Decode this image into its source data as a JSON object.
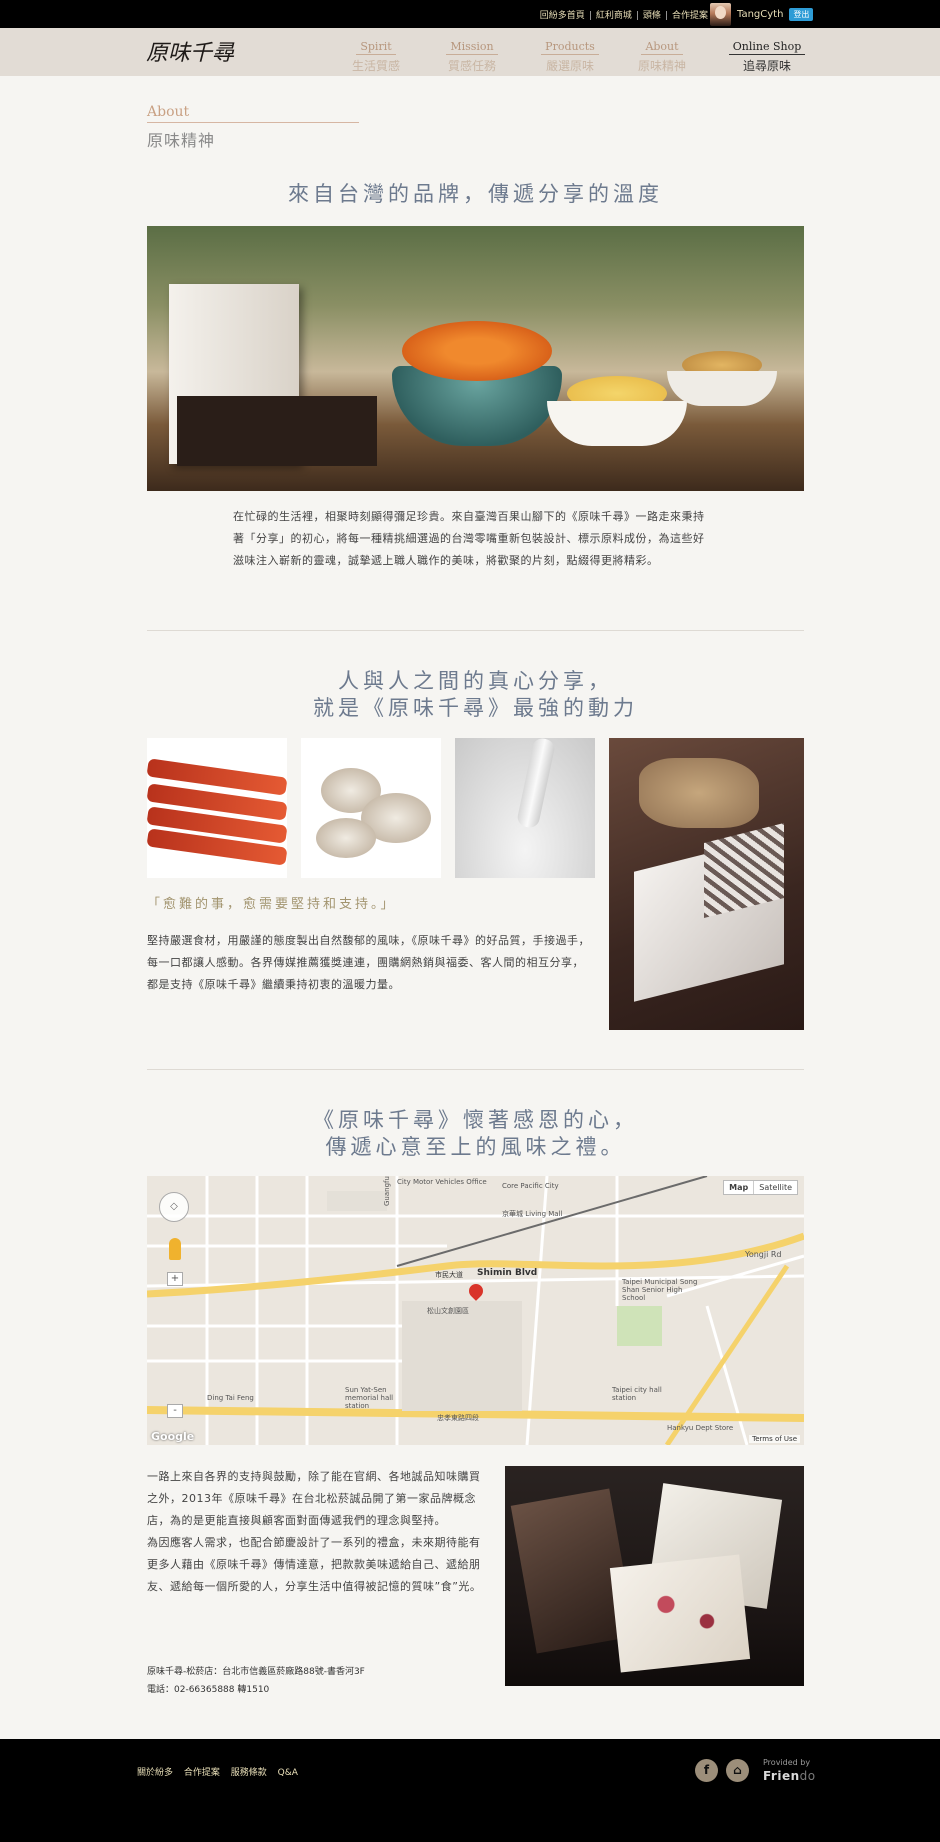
{
  "topbar": {
    "links": [
      "回紛多首頁",
      "紅利商城",
      "頭條",
      "合作提案"
    ],
    "user_name": "TangCyth",
    "logout_label": "登出"
  },
  "nav": {
    "logo_text": "原味千尋",
    "items": [
      {
        "en": "Spirit",
        "zh": "生活質感"
      },
      {
        "en": "Mission",
        "zh": "質感任務"
      },
      {
        "en": "Products",
        "zh": "嚴選原味"
      },
      {
        "en": "About",
        "zh": "原味精神"
      },
      {
        "en": "Online Shop",
        "zh": "追尋原味"
      }
    ]
  },
  "section": {
    "en": "About",
    "zh": "原味精神"
  },
  "headline1": "來自台灣的品牌，傳遞分享的溫度",
  "para1": "在忙碌的生活裡，相聚時刻顯得彌足珍貴。來自臺灣百果山腳下的《原味千尋》一路走來秉持著「分享」的初心，將每一種精挑細選過的台灣零嘴重新包裝設計、標示原料成份，為這些好滋味注入嶄新的靈魂，誠摯遞上職人職作的美味，將歡聚的片刻，點綴得更將精彩。",
  "headline2": [
    "人與人之間的真心分享，",
    "就是《原味千尋》最強的動力"
  ],
  "quote": "「愈難的事，愈需要堅持和支持。」",
  "para2": "堅持嚴選食材，用嚴謹的態度製出自然馥郁的風味，《原味千尋》的好品質，手接過手，每一口都讓人感動。各界傳媒推薦獲獎連連，團購網熱銷與福委、客人間的相互分享，都是支持《原味千尋》繼續秉持初衷的溫暖力量。",
  "headline3": [
    "《原味千尋》懷著感恩的心，",
    "傳遞心意至上的風味之禮。"
  ],
  "map": {
    "type_map": "Map",
    "type_satellite": "Satellite",
    "terms": "Terms of Use",
    "google": "Google",
    "labels": {
      "core_pacific": "Core Pacific City",
      "living_mall": "京華城 Living Mall",
      "shimin_blvd": "Shimin Blvd",
      "shimin_zh": "市民大道",
      "yongji": "Yongji Rd",
      "songshan_school": "Taipei Municipal Song Shan Senior High School",
      "sun_yatsen": "Sun Yat-Sen memorial hall station",
      "taipei_city_hall": "Taipei city hall station",
      "hankyu": "Hankyu Dept Store",
      "zhongxiao": "忠孝東路四段",
      "guangfu": "Guangfu South Rd",
      "songshan_zh": "松山文創園區",
      "vehicles_office": "City Motor Vehicles Office",
      "dingtai": "Ding Tai Feng"
    }
  },
  "para3": [
    "一路上來自各界的支持與鼓勵，除了能在官網、各地誠品知味購買之外，2013年《原味千尋》在台北松菸誠品開了第一家品牌概念店，為的是更能直接與顧客面對面傳遞我們的理念與堅持。",
    "為因應客人需求，也配合節慶設計了一系列的禮盒，未來期待能有更多人藉由《原味千尋》傳情達意，把款款美味遞給自己、遞給朋友、遞給每一個所愛的人，分享生活中值得被記憶的質味”食”光。"
  ],
  "store": {
    "address": "原味千尋-松菸店：台北市信義區菸廠路88號-書香河3F",
    "phone": "電話：02-66365888 轉1510"
  },
  "footer": {
    "links": [
      "關於紛多",
      "合作提案",
      "服務條款",
      "Q&A"
    ],
    "fb_icon": "f",
    "home_icon": "⌂",
    "provided_by": "Provided by",
    "brand_main": "Frien",
    "brand_tail": "do"
  }
}
